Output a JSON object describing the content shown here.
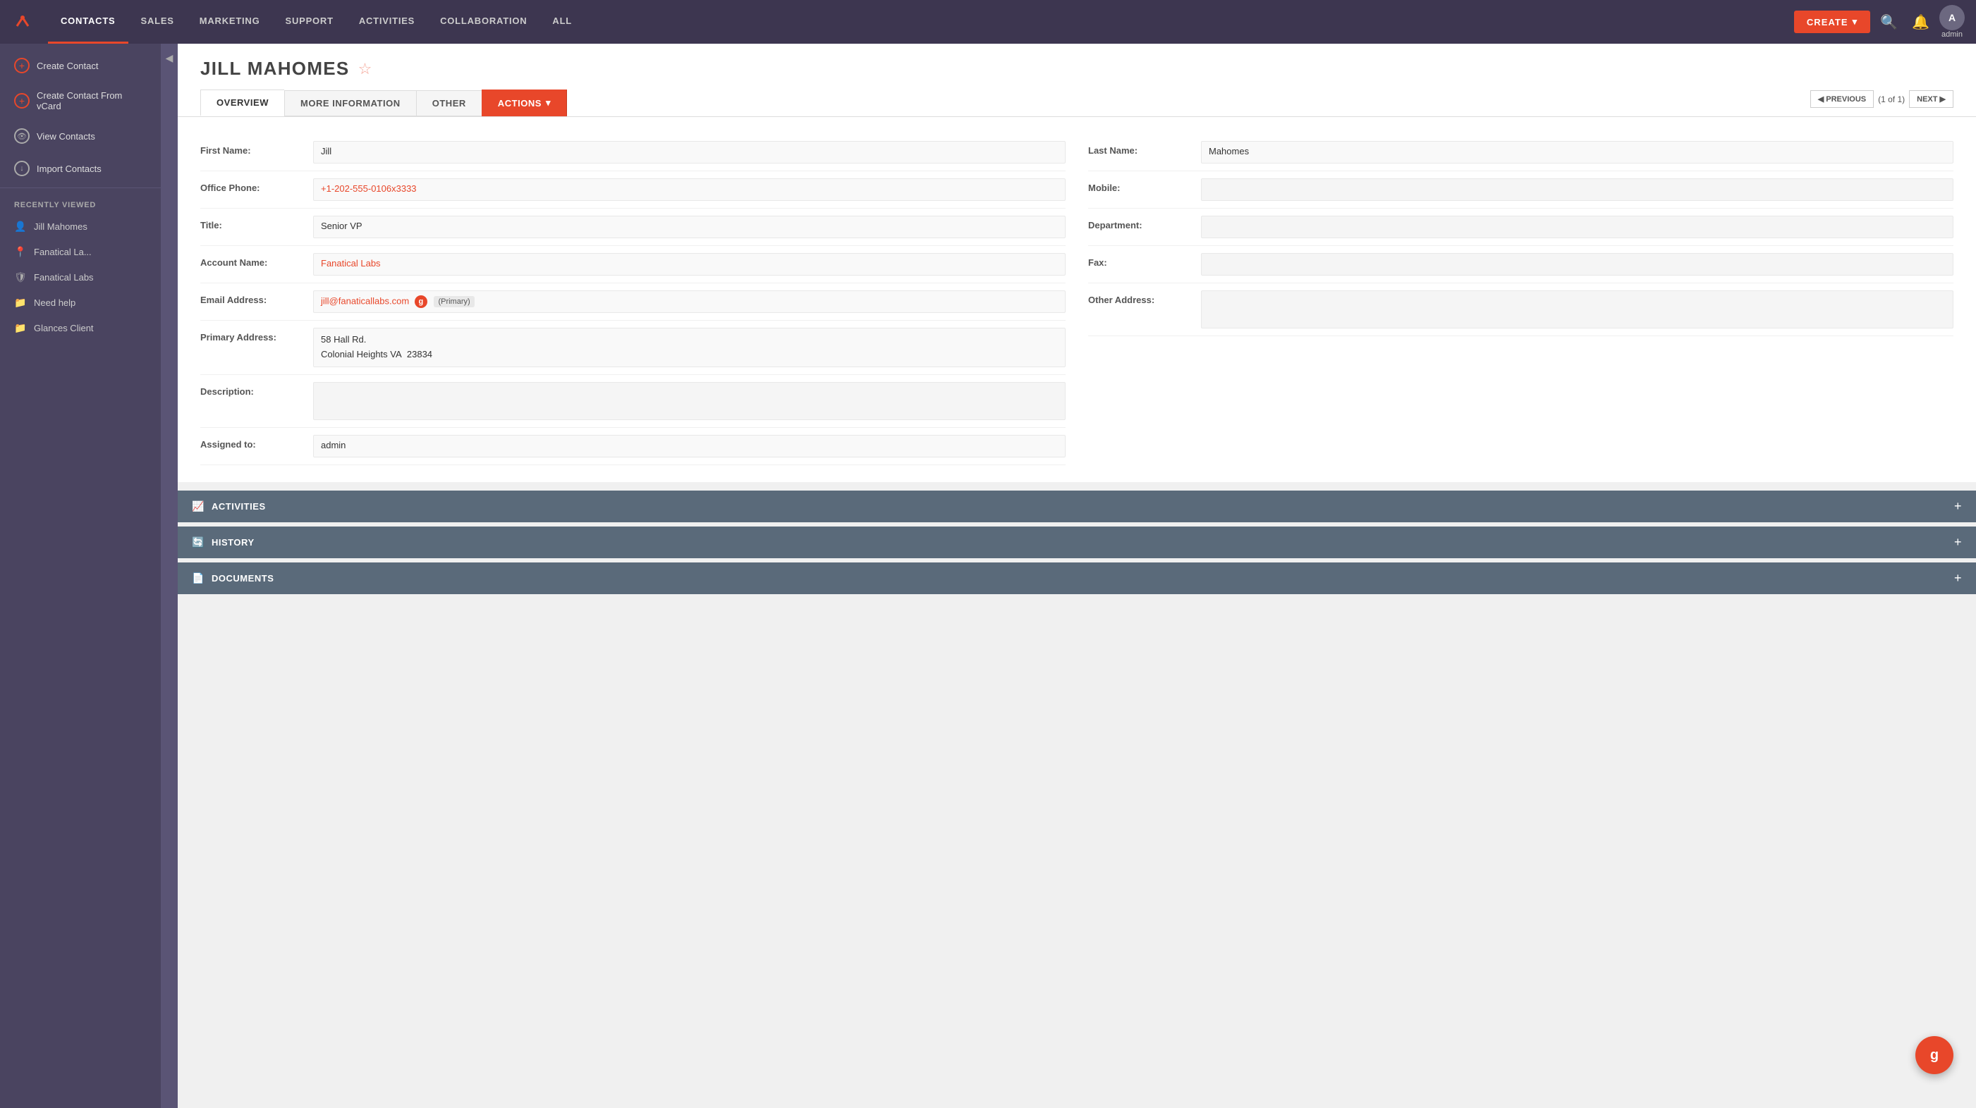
{
  "nav": {
    "logo_icon": "🏠",
    "items": [
      {
        "label": "CONTACTS",
        "active": true
      },
      {
        "label": "SALES",
        "active": false
      },
      {
        "label": "MARKETING",
        "active": false
      },
      {
        "label": "SUPPORT",
        "active": false
      },
      {
        "label": "ACTIVITIES",
        "active": false
      },
      {
        "label": "COLLABORATION",
        "active": false
      },
      {
        "label": "ALL",
        "active": false
      }
    ],
    "create_label": "CREATE",
    "admin_label": "admin"
  },
  "sidebar": {
    "actions": [
      {
        "label": "Create Contact",
        "icon_type": "plus"
      },
      {
        "label": "Create Contact From vCard",
        "icon_type": "plus"
      },
      {
        "label": "View Contacts",
        "icon_type": "eye"
      },
      {
        "label": "Import Contacts",
        "icon_type": "import"
      }
    ],
    "recently_viewed_label": "Recently Viewed",
    "recent_items": [
      {
        "label": "Jill Mahomes",
        "icon": "person"
      },
      {
        "label": "Fanatical La...",
        "icon": "pin"
      },
      {
        "label": "Fanatical Labs",
        "icon": "shield"
      },
      {
        "label": "Need help",
        "icon": "folder"
      },
      {
        "label": "Glances Client",
        "icon": "folder"
      }
    ]
  },
  "contact": {
    "name": "JILL MAHOMES",
    "tabs": [
      {
        "label": "OVERVIEW",
        "active": true
      },
      {
        "label": "MORE INFORMATION",
        "active": false
      },
      {
        "label": "OTHER",
        "active": false
      },
      {
        "label": "ACTIONS",
        "active": false,
        "has_arrow": true
      }
    ],
    "pagination": {
      "prev_label": "◀ PREVIOUS",
      "count_label": "(1 of 1)",
      "next_label": "NEXT ▶"
    },
    "fields": {
      "first_name_label": "First Name:",
      "first_name_value": "Jill",
      "last_name_label": "Last Name:",
      "last_name_value": "Mahomes",
      "office_phone_label": "Office Phone:",
      "office_phone_value": "+1-202-555-0106x3333",
      "mobile_label": "Mobile:",
      "mobile_value": "",
      "title_label": "Title:",
      "title_value": "Senior VP",
      "department_label": "Department:",
      "department_value": "",
      "account_name_label": "Account Name:",
      "account_name_value": "Fanatical Labs",
      "fax_label": "Fax:",
      "fax_value": "",
      "email_label": "Email Address:",
      "email_value": "jill@fanaticallabs.com",
      "email_badge": "(Primary)",
      "primary_address_label": "Primary Address:",
      "primary_address_value": "58 Hall Rd.\nColonial Heights VA  23834",
      "other_address_label": "Other Address:",
      "other_address_value": "",
      "description_label": "Description:",
      "description_value": "",
      "assigned_to_label": "Assigned to:",
      "assigned_to_value": "admin"
    },
    "subpanels": [
      {
        "label": "ACTIVITIES",
        "icon": "📈"
      },
      {
        "label": "HISTORY",
        "icon": "🔄"
      },
      {
        "label": "DOCUMENTS",
        "icon": "📄"
      }
    ]
  },
  "glances_fab": "g"
}
